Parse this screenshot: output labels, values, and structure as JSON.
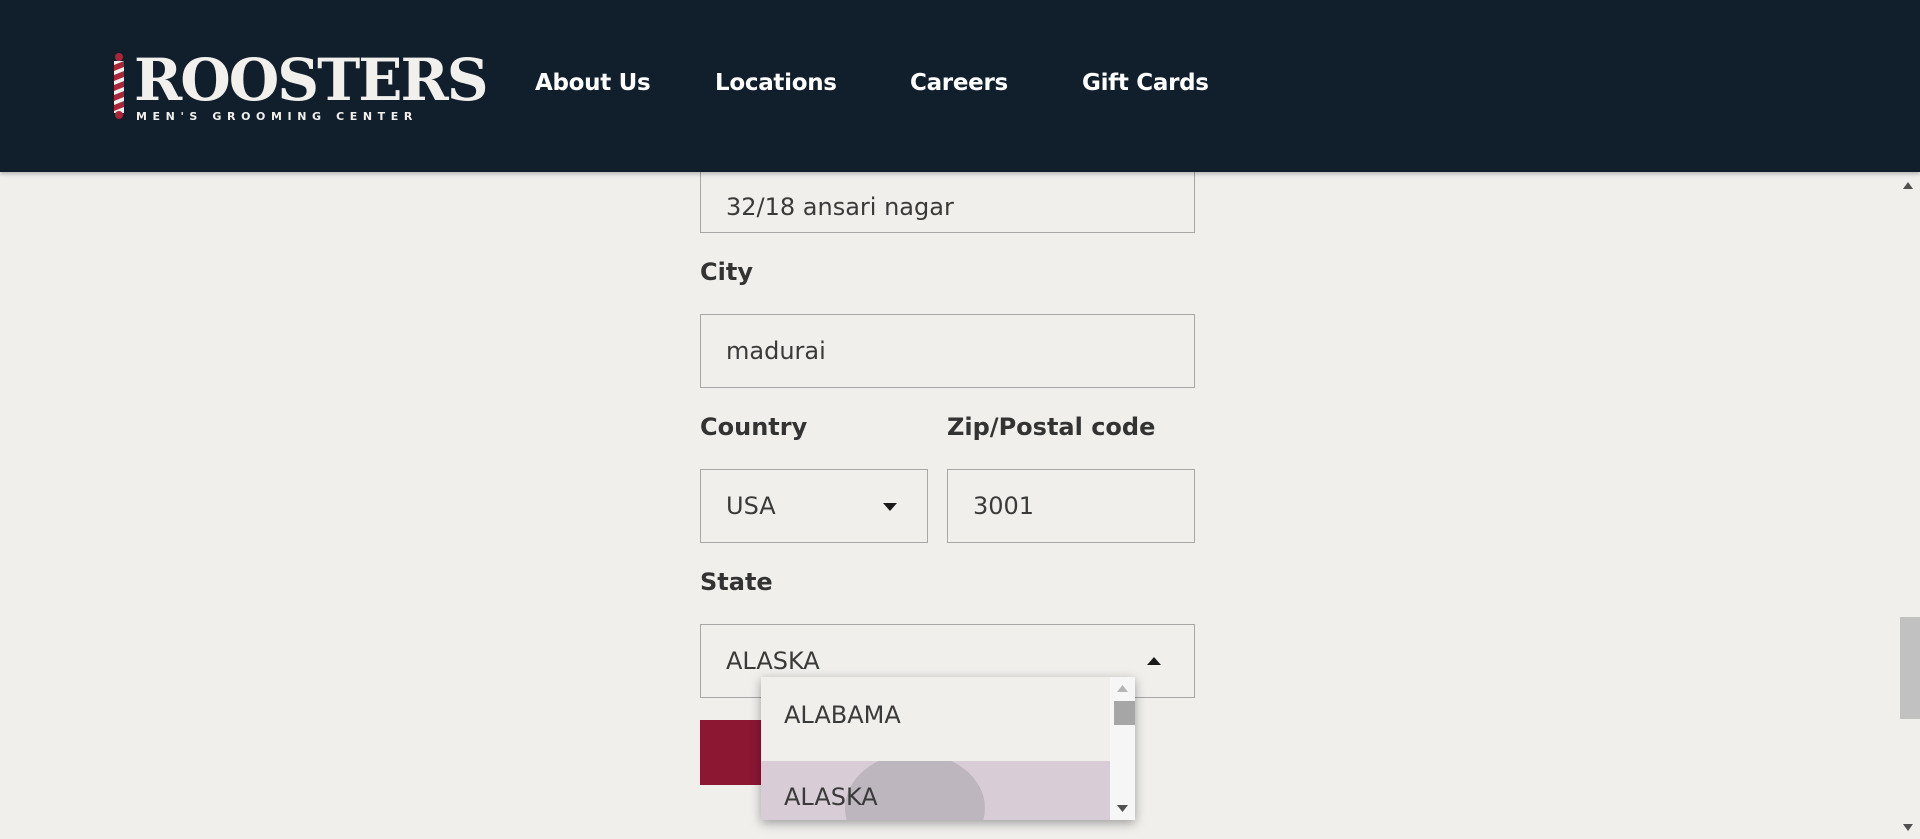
{
  "brand": {
    "name": "ROOSTERS",
    "tagline": "MEN'S GROOMING CENTER"
  },
  "nav": {
    "items": [
      {
        "label": "About Us"
      },
      {
        "label": "Locations"
      },
      {
        "label": "Careers"
      },
      {
        "label": "Gift Cards"
      }
    ]
  },
  "form": {
    "address_value": "32/18 ansari nagar",
    "city_label": "City",
    "city_value": "madurai",
    "country_label": "Country",
    "country_value": "USA",
    "zip_label": "Zip/Postal code",
    "zip_value": "3001",
    "state_label": "State",
    "state_value": "ALASKA"
  },
  "state_dropdown": {
    "options": [
      {
        "label": "ALABAMA",
        "selected": false
      },
      {
        "label": "ALASKA",
        "selected": true
      }
    ]
  },
  "colors": {
    "header_bg": "#111e2c",
    "page_bg": "#f0efec",
    "accent": "#8c1733",
    "selected_option": "#d8ccd6"
  },
  "icons": {
    "country_select": "chevron-down-icon",
    "state_select": "chevron-up-icon"
  }
}
